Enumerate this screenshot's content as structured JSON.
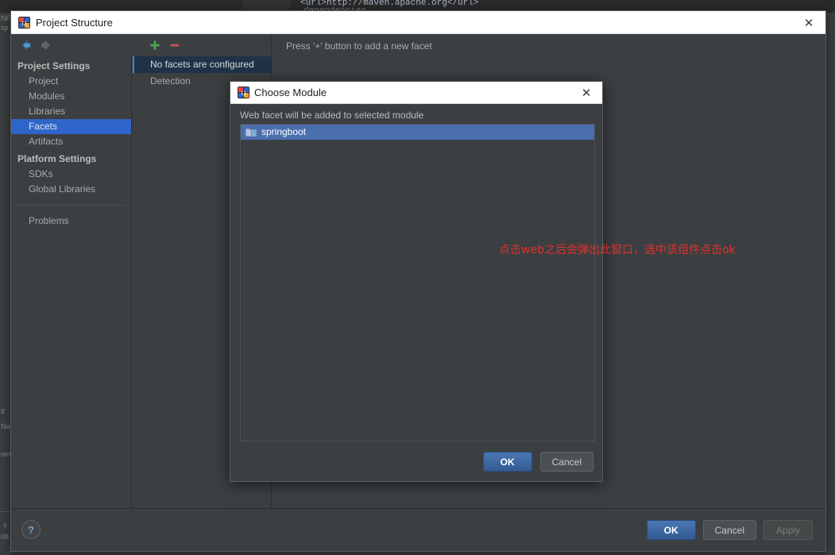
{
  "background": {
    "code_line_1": "<url>http://maven.apache.org</url>",
    "code_line_2": "dependencies",
    "left_fragments": [
      "NF",
      "sp",
      "tI",
      "Na",
      "om",
      "s",
      "08"
    ]
  },
  "project_structure": {
    "title": "Project Structure",
    "title_icon": "intellij-icon",
    "close_icon": "close-icon",
    "nav": {
      "back_icon": "back-arrow-icon",
      "forward_icon": "forward-arrow-icon"
    },
    "sidebar": {
      "groups": [
        {
          "label": "Project Settings",
          "items": [
            {
              "label": "Project",
              "selected": false
            },
            {
              "label": "Modules",
              "selected": false
            },
            {
              "label": "Libraries",
              "selected": false
            },
            {
              "label": "Facets",
              "selected": true
            },
            {
              "label": "Artifacts",
              "selected": false
            }
          ]
        },
        {
          "label": "Platform Settings",
          "items": [
            {
              "label": "SDKs",
              "selected": false
            },
            {
              "label": "Global Libraries",
              "selected": false
            }
          ]
        }
      ],
      "problems_label": "Problems"
    },
    "facets": {
      "toolbar": {
        "add_icon": "plus-icon",
        "remove_icon": "minus-icon"
      },
      "rows": [
        {
          "label": "No facets are configured",
          "selected": true
        },
        {
          "label": "Detection",
          "selected": false
        }
      ]
    },
    "detail_hint": "Press '+' button to add a new facet",
    "footer": {
      "help_label": "?",
      "ok_label": "OK",
      "cancel_label": "Cancel",
      "apply_label": "Apply"
    }
  },
  "choose_module": {
    "title": "Choose Module",
    "title_icon": "intellij-icon",
    "close_icon": "close-icon",
    "description": "Web facet will be added to selected module",
    "modules": [
      {
        "label": "springboot",
        "icon": "module-folder-icon",
        "selected": true
      }
    ],
    "annotation": "点击web之后会弹出此窗口，选中该组件点击ok",
    "annotation_color": "#e03030",
    "ok_label": "OK",
    "cancel_label": "Cancel"
  },
  "colors": {
    "panel_bg": "#3c3f41",
    "selection_blue": "#2f65ca",
    "list_selection_blue": "#4b6eaf",
    "default_button_blue": "#3f6aa8",
    "text": "#a9a9a9"
  }
}
